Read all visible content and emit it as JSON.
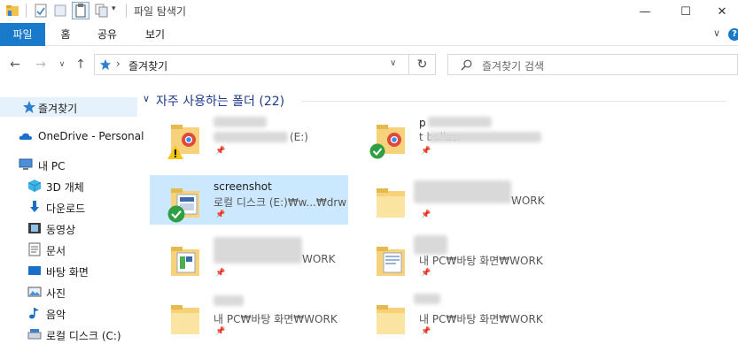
{
  "window": {
    "title": "파일 탐색기",
    "minimize_glyph": "—",
    "maximize_glyph": "☐",
    "close_glyph": "✕"
  },
  "ribbon": {
    "tabs": [
      "파일",
      "홈",
      "공유",
      "보기"
    ],
    "expand_glyph": "∨",
    "help_glyph": "?"
  },
  "nav": {
    "back_glyph": "←",
    "forward_glyph": "→",
    "recent_glyph": "∨",
    "up_glyph": "↑",
    "address_sep": "›",
    "address": "즐겨찾기",
    "address_dropdown": "∨",
    "refresh_glyph": "↻",
    "search_placeholder": "즐겨찾기 검색"
  },
  "sidebar": {
    "items": [
      {
        "label": "즐겨찾기",
        "icon": "star-icon",
        "selected": true
      },
      {
        "label": "OneDrive - Personal",
        "icon": "cloud-icon"
      },
      {
        "label": "내 PC",
        "icon": "pc-icon"
      },
      {
        "label": "3D 개체",
        "icon": "cube-icon"
      },
      {
        "label": "다운로드",
        "icon": "download-icon"
      },
      {
        "label": "동영상",
        "icon": "video-icon"
      },
      {
        "label": "문서",
        "icon": "document-icon"
      },
      {
        "label": "바탕 화면",
        "icon": "desktop-icon"
      },
      {
        "label": "사진",
        "icon": "picture-icon"
      },
      {
        "label": "음악",
        "icon": "music-icon"
      },
      {
        "label": "로컬 디스크 (C:)",
        "icon": "drive-icon"
      }
    ]
  },
  "main": {
    "section_title": "자주 사용하는 폴더 (22)",
    "section_chevron": "∨",
    "pin_glyph": "📌",
    "tiles": [
      {
        "name": "",
        "path": "(E:)",
        "badge": "warning-badge"
      },
      {
        "name": "p",
        "path": "t                    balizer",
        "badge": "check-badge"
      },
      {
        "name": "screenshot",
        "path": "로컬 디스크 (E:)₩w...₩drw",
        "badge": "check-badge",
        "selected": true
      },
      {
        "name": "",
        "path": "WORK"
      },
      {
        "name": "",
        "path": "WORK"
      },
      {
        "name": "",
        "path": "내 PC₩바탕 화면₩WORK"
      },
      {
        "name": "",
        "path": "내 PC₩바탕 화면₩WORK"
      },
      {
        "name": "",
        "path": "내 PC₩바탕 화면₩WORK"
      }
    ]
  }
}
